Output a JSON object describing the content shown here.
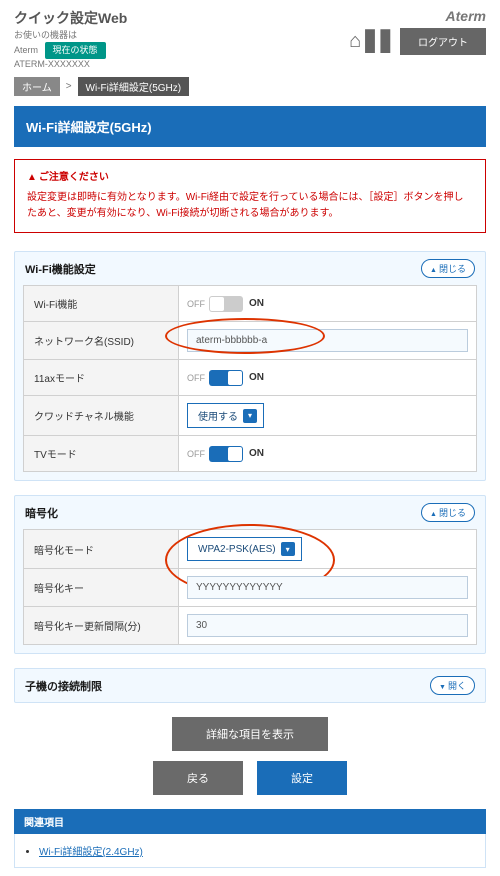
{
  "header": {
    "brand": "クイック設定Web",
    "deviceLabel": "お使いの機器は",
    "deviceLine1": "Aterm",
    "deviceLine2": "ATERM-XXXXXXX",
    "statusBtn": "現在の状態",
    "logo": "Aterm",
    "logout": "ログアウト"
  },
  "crumbs": {
    "home": "ホーム",
    "sep": ">",
    "page": "Wi-Fi詳細設定(5GHz)"
  },
  "title": "Wi-Fi詳細設定(5GHz)",
  "notice": {
    "h": "ご注意ください",
    "body": "設定変更は即時に有効となります。Wi-Fi経由で設定を行っている場合には、［設定］ボタンを押したあと、変更が有効になり、Wi-Fi接続が切断される場合があります。"
  },
  "panel1": {
    "title": "Wi-Fi機能設定",
    "toggle": "閉じる",
    "rows": {
      "wifi": {
        "label": "Wi-Fi機能",
        "off": "OFF",
        "on": "ON"
      },
      "ssid": {
        "label": "ネットワーク名(SSID)",
        "value": "aterm-bbbbbb-a"
      },
      "ax": {
        "label": "11axモード",
        "off": "OFF",
        "on": "ON"
      },
      "quad": {
        "label": "クワッドチャネル機能",
        "value": "使用する"
      },
      "tv": {
        "label": "TVモード",
        "off": "OFF",
        "on": "ON"
      }
    }
  },
  "panel2": {
    "title": "暗号化",
    "toggle": "閉じる",
    "rows": {
      "mode": {
        "label": "暗号化モード",
        "value": "WPA2-PSK(AES)"
      },
      "key": {
        "label": "暗号化キー",
        "value": "YYYYYYYYYYYYY"
      },
      "interval": {
        "label": "暗号化キー更新間隔(分)",
        "value": "30"
      }
    }
  },
  "panel3": {
    "title": "子機の接続制限",
    "toggle": "開く"
  },
  "buttons": {
    "detail": "詳細な項目を表示",
    "back": "戻る",
    "apply": "設定"
  },
  "related": {
    "h": "関連項目",
    "link": "Wi-Fi詳細設定(2.4GHz)"
  }
}
